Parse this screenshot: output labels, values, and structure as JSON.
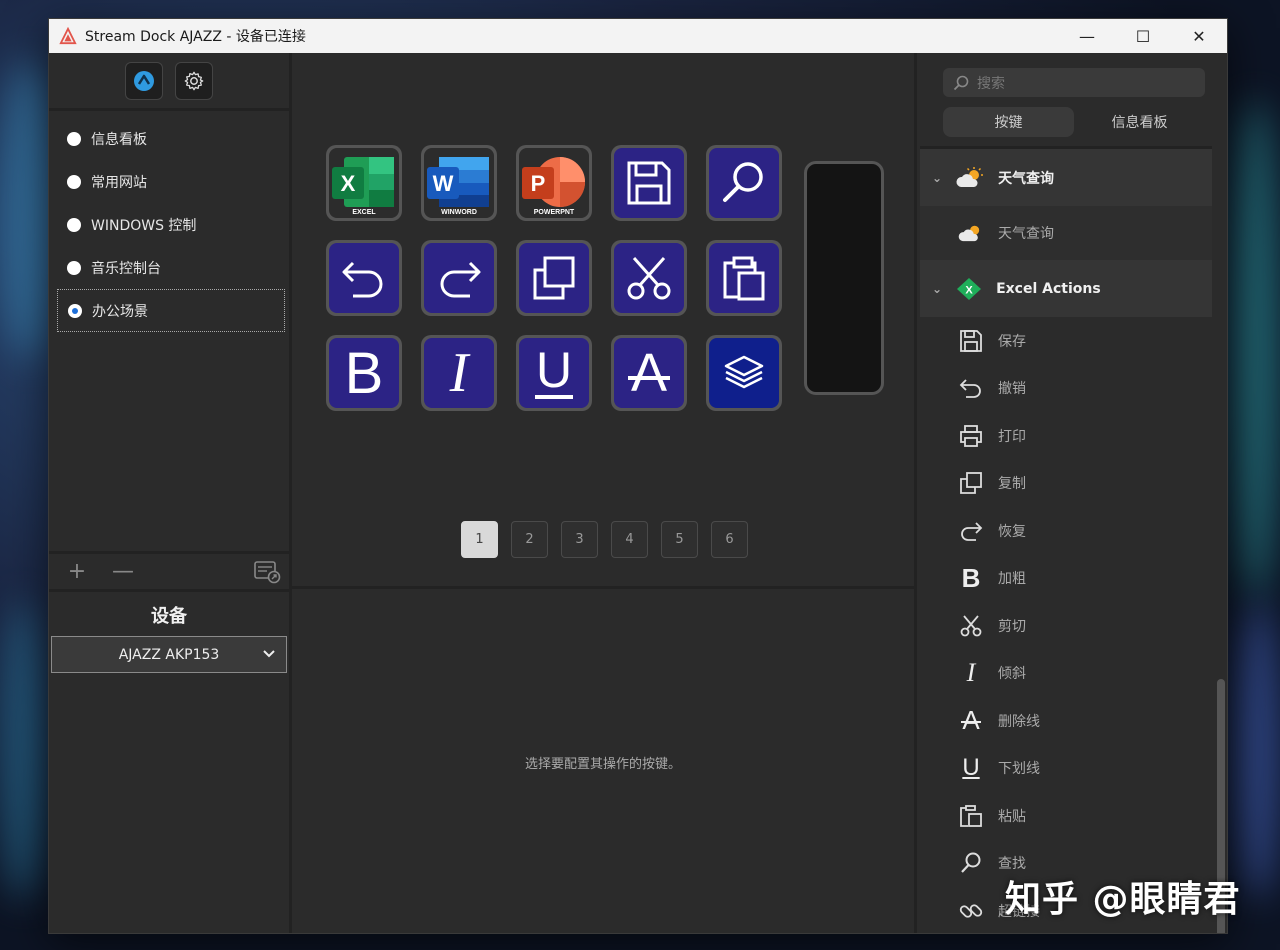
{
  "window": {
    "title": "Stream Dock AJAZZ - 设备已连接",
    "controls": {
      "minimize": "—",
      "maximize": "☐",
      "close": "✕"
    }
  },
  "left": {
    "profiles": [
      {
        "label": "信息看板",
        "selected": false
      },
      {
        "label": "常用网站",
        "selected": false
      },
      {
        "label": "WINDOWS 控制",
        "selected": false
      },
      {
        "label": "音乐控制台",
        "selected": false
      },
      {
        "label": "办公场景",
        "selected": true
      }
    ],
    "add_label": "+",
    "remove_label": "—",
    "device_title": "设备",
    "device_selected": "AJAZZ AKP153"
  },
  "center": {
    "keys": [
      {
        "name": "excel",
        "caption": "EXCEL",
        "type": "app",
        "icon": "excel-icon"
      },
      {
        "name": "word",
        "caption": "WINWORD",
        "type": "app",
        "icon": "word-icon"
      },
      {
        "name": "powerpoint",
        "caption": "POWERPNT",
        "type": "app",
        "icon": "powerpoint-icon"
      },
      {
        "name": "save",
        "type": "action",
        "icon": "save-icon"
      },
      {
        "name": "find",
        "type": "action",
        "icon": "search-icon"
      },
      {
        "name": "undo",
        "type": "action",
        "icon": "undo-icon"
      },
      {
        "name": "redo",
        "type": "action",
        "icon": "redo-icon"
      },
      {
        "name": "copy",
        "type": "action",
        "icon": "copy-icon"
      },
      {
        "name": "cut",
        "type": "action",
        "icon": "scissors-icon"
      },
      {
        "name": "paste",
        "type": "action",
        "icon": "paste-icon"
      },
      {
        "name": "bold",
        "type": "action",
        "icon": "bold-icon",
        "glyph": "B"
      },
      {
        "name": "italic",
        "type": "action",
        "icon": "italic-icon",
        "glyph": "I"
      },
      {
        "name": "underline",
        "type": "action",
        "icon": "underline-icon",
        "glyph": "U"
      },
      {
        "name": "strikethrough",
        "type": "action",
        "icon": "strikethrough-icon",
        "glyph": "A"
      },
      {
        "name": "layers",
        "type": "action",
        "icon": "layers-icon"
      }
    ],
    "pages": [
      "1",
      "2",
      "3",
      "4",
      "5",
      "6"
    ],
    "active_page": "1",
    "hint": "选择要配置其操作的按键。"
  },
  "right": {
    "search_placeholder": "搜索",
    "tabs": [
      "按键",
      "信息看板"
    ],
    "active_tab": "按键",
    "categories": [
      {
        "label": "天气查询",
        "icon": "weather-icon",
        "items": [
          {
            "label": "天气查询",
            "icon": "weather-icon"
          }
        ]
      },
      {
        "label": "Excel Actions",
        "icon": "excel-icon",
        "items": [
          {
            "label": "保存",
            "icon": "save-icon"
          },
          {
            "label": "撤销",
            "icon": "undo-icon"
          },
          {
            "label": "打印",
            "icon": "printer-icon"
          },
          {
            "label": "复制",
            "icon": "copy-icon"
          },
          {
            "label": "恢复",
            "icon": "redo-icon"
          },
          {
            "label": "加粗",
            "icon": "bold-icon"
          },
          {
            "label": "剪切",
            "icon": "scissors-icon"
          },
          {
            "label": "倾斜",
            "icon": "italic-icon"
          },
          {
            "label": "删除线",
            "icon": "strikethrough-icon"
          },
          {
            "label": "下划线",
            "icon": "underline-icon"
          },
          {
            "label": "粘贴",
            "icon": "paste-icon"
          },
          {
            "label": "查找",
            "icon": "search-icon"
          },
          {
            "label": "超链接",
            "icon": "link-icon"
          }
        ]
      }
    ]
  },
  "watermark": "知乎 @眼睛君",
  "colors": {
    "key_blue": "#2c2385",
    "key_dark_blue": "#0f1f8c",
    "panel": "#2b2b2b",
    "accent_radio": "#1e6fd9"
  }
}
